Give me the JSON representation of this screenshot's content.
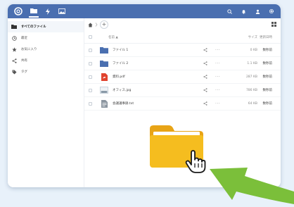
{
  "sidebar": {
    "items": [
      {
        "label": "すべてのファイル",
        "icon": "folder-icon",
        "active": true
      },
      {
        "label": "最近",
        "icon": "clock-icon",
        "active": false
      },
      {
        "label": "お気に入り",
        "icon": "star-icon",
        "active": false
      },
      {
        "label": "共有",
        "icon": "share-icon",
        "active": false
      },
      {
        "label": "タグ",
        "icon": "tag-icon",
        "active": false
      }
    ]
  },
  "table": {
    "columns": {
      "name": "名前 ▲",
      "size": "サイズ",
      "modified": "更新日時"
    },
    "rows": [
      {
        "name": "ファイル 1",
        "type": "folder",
        "size": "0 KB",
        "modified": "数秒前"
      },
      {
        "name": "ファイル 2",
        "type": "folder",
        "size": "1.1 KB",
        "modified": "数秒前"
      },
      {
        "name": "資料.pdf",
        "type": "pdf",
        "size": "287 KB",
        "modified": "数秒前"
      },
      {
        "name": "オフィス.jpg",
        "type": "image",
        "size": "786 KB",
        "modified": "数秒前"
      },
      {
        "name": "会議議事録.txt",
        "type": "text",
        "size": "64 KB",
        "modified": "数秒前"
      }
    ]
  },
  "colors": {
    "topbar": "#4a6fb0",
    "folder": "#4a6fb0",
    "big_folder": "#f5bd1f",
    "arrow": "#7bbf3a",
    "pdf": "#e0432e"
  }
}
